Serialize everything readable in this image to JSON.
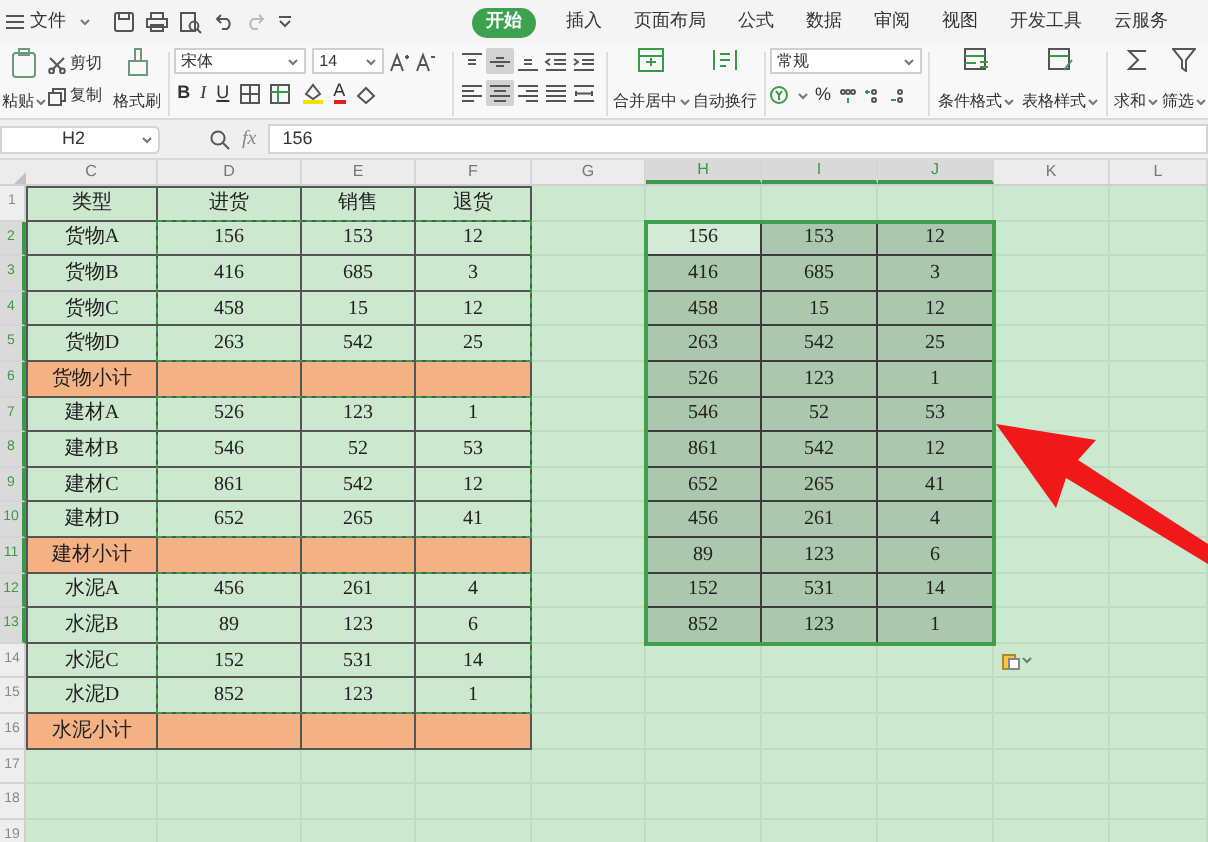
{
  "menu_bar": {
    "file_menu": "文件",
    "tabs": [
      {
        "label": "开始",
        "selected": true
      },
      {
        "label": "插入",
        "selected": false
      },
      {
        "label": "页面布局",
        "selected": false
      },
      {
        "label": "公式",
        "selected": false
      },
      {
        "label": "数据",
        "selected": false
      },
      {
        "label": "审阅",
        "selected": false
      },
      {
        "label": "视图",
        "selected": false
      },
      {
        "label": "开发工具",
        "selected": false
      },
      {
        "label": "云服务",
        "selected": false
      }
    ]
  },
  "ribbon": {
    "paste": "粘贴",
    "cut": "剪切",
    "copy": "复制",
    "format_painter": "格式刷",
    "font_name": "宋体",
    "font_size": "14",
    "bold": "B",
    "italic": "I",
    "underline": "U",
    "font_color": "A",
    "alignment": [
      {
        "kind": "top",
        "selected": false
      },
      {
        "kind": "middle",
        "selected": true
      },
      {
        "kind": "bottom",
        "selected": false
      },
      {
        "kind": "outdent",
        "selected": false
      },
      {
        "kind": "indent",
        "selected": false
      },
      {
        "kind": "left",
        "selected": false
      },
      {
        "kind": "center",
        "selected": true
      },
      {
        "kind": "right",
        "selected": false
      },
      {
        "kind": "justify",
        "selected": false
      },
      {
        "kind": "distributed",
        "selected": false
      }
    ],
    "merge": "合并居中",
    "wrap": "自动换行",
    "number_format": "常规",
    "percent": "%",
    "conditional_format": "条件格式",
    "table_style": "表格样式",
    "sum": "求和",
    "filter": "筛选"
  },
  "formula_bar": {
    "name_box": "H2",
    "fx": "fx",
    "value": "156"
  },
  "sheet": {
    "columns": [
      {
        "label": "C",
        "selected": false
      },
      {
        "label": "D",
        "selected": false
      },
      {
        "label": "E",
        "selected": false
      },
      {
        "label": "F",
        "selected": false
      },
      {
        "label": "G",
        "selected": false
      },
      {
        "label": "H",
        "selected": true
      },
      {
        "label": "I",
        "selected": true
      },
      {
        "label": "J",
        "selected": true
      },
      {
        "label": "K",
        "selected": false
      },
      {
        "label": "L",
        "selected": false
      }
    ],
    "rows": [
      {
        "label": "1",
        "selected": false
      },
      {
        "label": "2",
        "selected": true
      },
      {
        "label": "3",
        "selected": true
      },
      {
        "label": "4",
        "selected": true
      },
      {
        "label": "5",
        "selected": true
      },
      {
        "label": "6",
        "selected": true
      },
      {
        "label": "7",
        "selected": true
      },
      {
        "label": "8",
        "selected": true
      },
      {
        "label": "9",
        "selected": true
      },
      {
        "label": "10",
        "selected": true
      },
      {
        "label": "11",
        "selected": true
      },
      {
        "label": "12",
        "selected": true
      },
      {
        "label": "13",
        "selected": true
      },
      {
        "label": "14",
        "selected": false
      },
      {
        "label": "15",
        "selected": false
      },
      {
        "label": "16",
        "selected": false
      },
      {
        "label": "17",
        "selected": false
      },
      {
        "label": "18",
        "selected": false
      },
      {
        "label": "19",
        "selected": false
      }
    ],
    "table": {
      "header": [
        "类型",
        "进货",
        "销售",
        "退货"
      ],
      "rows": [
        {
          "kind": "item",
          "cells": [
            "货物A",
            "156",
            "153",
            "12"
          ]
        },
        {
          "kind": "item",
          "cells": [
            "货物B",
            "416",
            "685",
            "3"
          ]
        },
        {
          "kind": "item",
          "cells": [
            "货物C",
            "458",
            "15",
            "12"
          ]
        },
        {
          "kind": "item",
          "cells": [
            "货物D",
            "263",
            "542",
            "25"
          ]
        },
        {
          "kind": "subtotal",
          "cells": [
            "货物小计"
          ]
        },
        {
          "kind": "item",
          "cells": [
            "建材A",
            "526",
            "123",
            "1"
          ]
        },
        {
          "kind": "item",
          "cells": [
            "建材B",
            "546",
            "52",
            "53"
          ]
        },
        {
          "kind": "item",
          "cells": [
            "建材C",
            "861",
            "542",
            "12"
          ]
        },
        {
          "kind": "item",
          "cells": [
            "建材D",
            "652",
            "265",
            "41"
          ]
        },
        {
          "kind": "subtotal",
          "cells": [
            "建材小计"
          ]
        },
        {
          "kind": "item",
          "cells": [
            "水泥A",
            "456",
            "261",
            "4"
          ]
        },
        {
          "kind": "item",
          "cells": [
            "水泥B",
            "89",
            "123",
            "6"
          ]
        },
        {
          "kind": "item",
          "cells": [
            "水泥C",
            "152",
            "531",
            "14"
          ]
        },
        {
          "kind": "item",
          "cells": [
            "水泥D",
            "852",
            "123",
            "1"
          ]
        },
        {
          "kind": "subtotal",
          "cells": [
            "水泥小计"
          ]
        }
      ]
    },
    "pasted": {
      "rows": [
        [
          {
            "text": "156",
            "active": true
          },
          {
            "text": "153",
            "active": false
          },
          {
            "text": "12",
            "active": false
          }
        ],
        [
          {
            "text": "416",
            "active": false
          },
          {
            "text": "685",
            "active": false
          },
          {
            "text": "3",
            "active": false
          }
        ],
        [
          {
            "text": "458",
            "active": false
          },
          {
            "text": "15",
            "active": false
          },
          {
            "text": "12",
            "active": false
          }
        ],
        [
          {
            "text": "263",
            "active": false
          },
          {
            "text": "542",
            "active": false
          },
          {
            "text": "25",
            "active": false
          }
        ],
        [
          {
            "text": "526",
            "active": false
          },
          {
            "text": "123",
            "active": false
          },
          {
            "text": "1",
            "active": false
          }
        ],
        [
          {
            "text": "546",
            "active": false
          },
          {
            "text": "52",
            "active": false
          },
          {
            "text": "53",
            "active": false
          }
        ],
        [
          {
            "text": "861",
            "active": false
          },
          {
            "text": "542",
            "active": false
          },
          {
            "text": "12",
            "active": false
          }
        ],
        [
          {
            "text": "652",
            "active": false
          },
          {
            "text": "265",
            "active": false
          },
          {
            "text": "41",
            "active": false
          }
        ],
        [
          {
            "text": "456",
            "active": false
          },
          {
            "text": "261",
            "active": false
          },
          {
            "text": "4",
            "active": false
          }
        ],
        [
          {
            "text": "89",
            "active": false
          },
          {
            "text": "123",
            "active": false
          },
          {
            "text": "6",
            "active": false
          }
        ],
        [
          {
            "text": "152",
            "active": false
          },
          {
            "text": "531",
            "active": false
          },
          {
            "text": "14",
            "active": false
          }
        ],
        [
          {
            "text": "852",
            "active": false
          },
          {
            "text": "123",
            "active": false
          },
          {
            "text": "1",
            "active": false
          }
        ]
      ]
    }
  }
}
